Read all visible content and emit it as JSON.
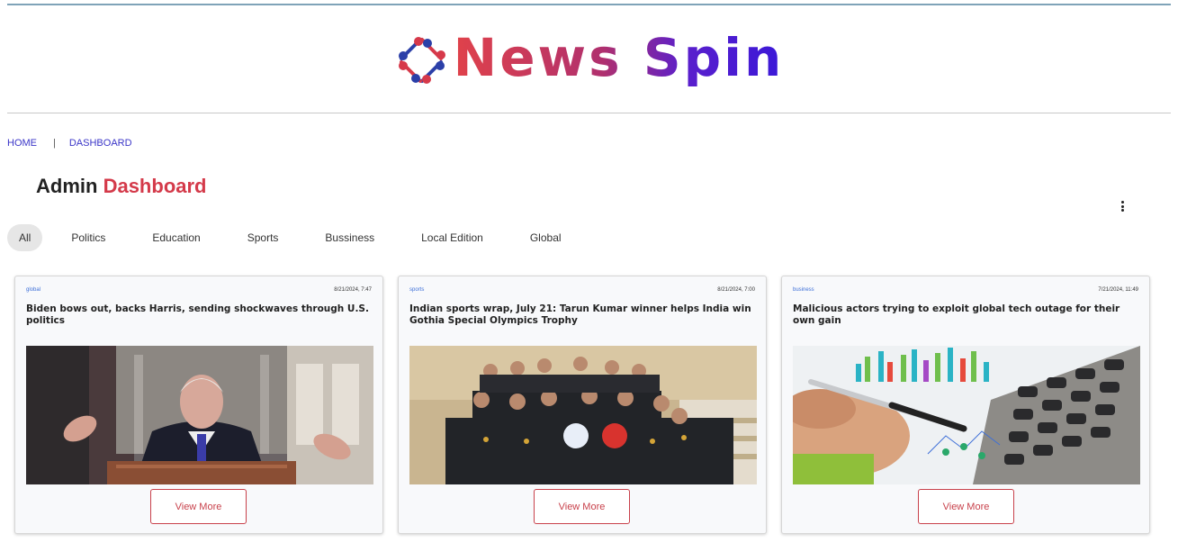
{
  "brand": {
    "name": "News Spin",
    "logo_icon": "spin-logo-icon"
  },
  "breadcrumb": {
    "home": "HOME",
    "separator": "|",
    "current": "DASHBOARD"
  },
  "page_title": {
    "prefix": "Admin",
    "accent": "Dashboard"
  },
  "menu_icon": "more-vertical-icon",
  "filters": [
    "All",
    "Politics",
    "Education",
    "Sports",
    "Bussiness",
    "Local Edition",
    "Global"
  ],
  "active_filter": "All",
  "cards": [
    {
      "category": "global",
      "date": "8/21/2024, 7:47",
      "headline": "Biden bows out, backs Harris, sending shockwaves through U.S. politics",
      "button": "View More",
      "photo_alt": "biden-speech-photo"
    },
    {
      "category": "sports",
      "date": "8/21/2024, 7:00",
      "headline": "Indian sports wrap, July 21: Tarun Kumar winner helps India win Gothia Special Olympics Trophy",
      "button": "View More",
      "photo_alt": "team-photo"
    },
    {
      "category": "business",
      "date": "7/21/2024, 11:49",
      "headline": "Malicious actors trying to exploit global tech outage for their own gain",
      "button": "View More",
      "photo_alt": "calculator-chart-photo"
    }
  ],
  "colors": {
    "accent": "#d43a4a",
    "link": "#3b36c8",
    "brand_start": "#e0424a",
    "brand_end": "#3a18d8"
  }
}
